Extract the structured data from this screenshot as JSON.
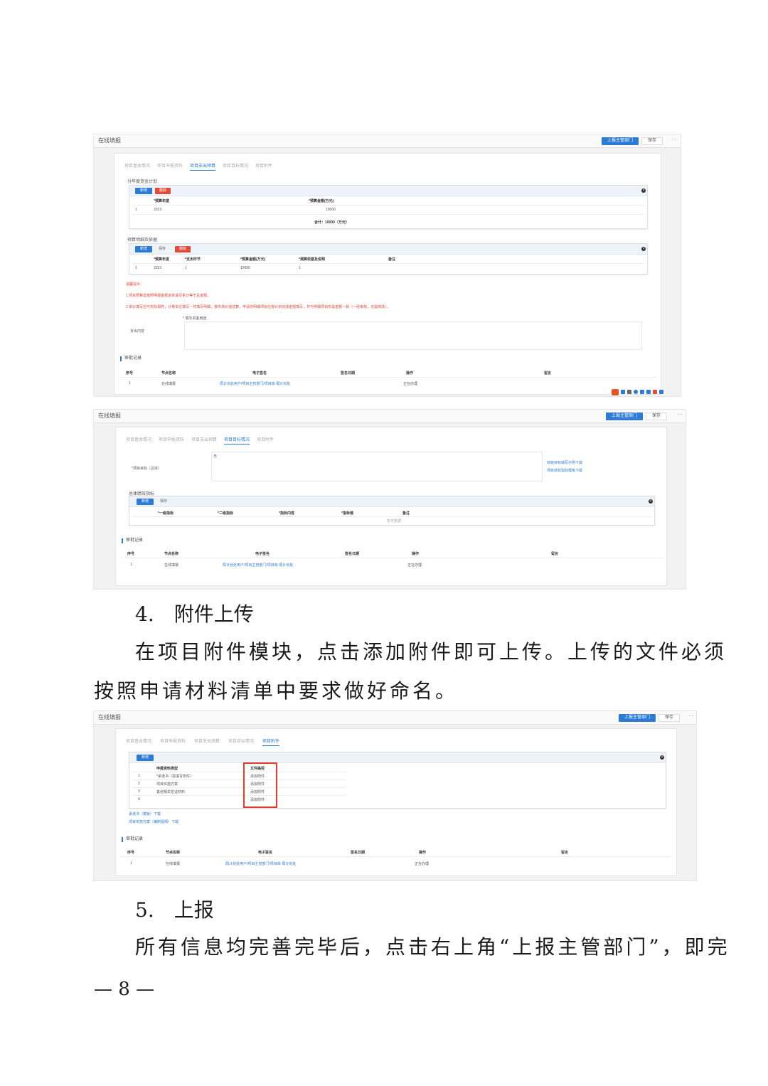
{
  "screens": {
    "window_title": "在线填报",
    "report_button": "上报主管部门",
    "save_button": "保存",
    "more_glyph": "···",
    "tabs": [
      "项目基本情况",
      "项目申报资料",
      "项目支出预算",
      "项目目标情况",
      "项目附件"
    ],
    "add_label": "新增",
    "save_small": "保存",
    "delete_label": "删除",
    "audit": {
      "section_title": "审批记录",
      "headers": [
        "序号",
        "节点名称",
        "电子签名",
        "签名日期",
        "操作",
        "留言"
      ],
      "row": {
        "index": "1",
        "node": "在线填报",
        "signature": "局计划处用户/项目主管部门/项目库-局计划处",
        "date": "",
        "action": "正在办理",
        "note": ""
      }
    }
  },
  "screen1": {
    "fund_plan": {
      "title": "分年度资金计划",
      "headers": [
        "*预算年度",
        "*预算金额(万元)"
      ],
      "row": {
        "index": "1",
        "year": "2023",
        "amount": "10000"
      },
      "total": "合计：10000（万元）"
    },
    "budget_detail": {
      "title": "预算明细及依据",
      "headers": [
        "*预算年度",
        "*支出环节",
        "*预算金额(万元)",
        "*测算依据及说明",
        "备注"
      ],
      "row": {
        "index": "1",
        "year": "2023",
        "stage": "1",
        "amount": "10000",
        "basis": "1",
        "note": ""
      }
    },
    "warnings": [
      "温馨提示：",
      "1.项目预算需按照明细金额逐条填写累计等于总金额。",
      "2.单价填写应与实际相符，计量单位填写一并填写明细，按市场价值估算，申请的明细项目应按计划完成金额填写，并与明细项目所需金额一致（一经审核，无需修改）。"
    ],
    "other_label": "支出内容",
    "other_hint": "* 填写资金用途"
  },
  "screen2": {
    "goal_label": "*项目目标（总体）",
    "goal_value": "无",
    "links": [
      "绩效目标填写示例下载",
      "项目绩效指标模板下载"
    ],
    "perf_title": "总体绩效指标",
    "perf_headers": [
      "*一级指标",
      "*二级指标",
      "*指标内容",
      "*指标值",
      "备注"
    ],
    "empty_text": "暂无数据"
  },
  "screen3": {
    "headers": [
      "申报资料类型",
      "文件路径"
    ],
    "rows": [
      {
        "index": "1",
        "type": "*承诺书（需填写附件）",
        "path": "添加附件"
      },
      {
        "index": "2",
        "type": "项目实施方案",
        "path": "添加附件"
      },
      {
        "index": "3",
        "type": "其他相关佐证材料",
        "path": "添加附件"
      },
      {
        "index": "4",
        "type": "",
        "path": "添加附件"
      }
    ],
    "downloads": [
      "承诺书（模板）下载",
      "项目实施方案（编制提纲）下载"
    ]
  },
  "doc": {
    "section4_heading": "4.　附件上传",
    "section4_body_line1": "在项目附件模块，点击添加附件即可上传。上传的文件必须",
    "section4_body_line2": "按照申请材料清单中要求做好命名。",
    "section5_heading": "5.　上报",
    "section5_body_line1": "所有信息均完善完毕后，点击右上角“上报主管部门”，即完",
    "page_number": "— 8 —"
  }
}
